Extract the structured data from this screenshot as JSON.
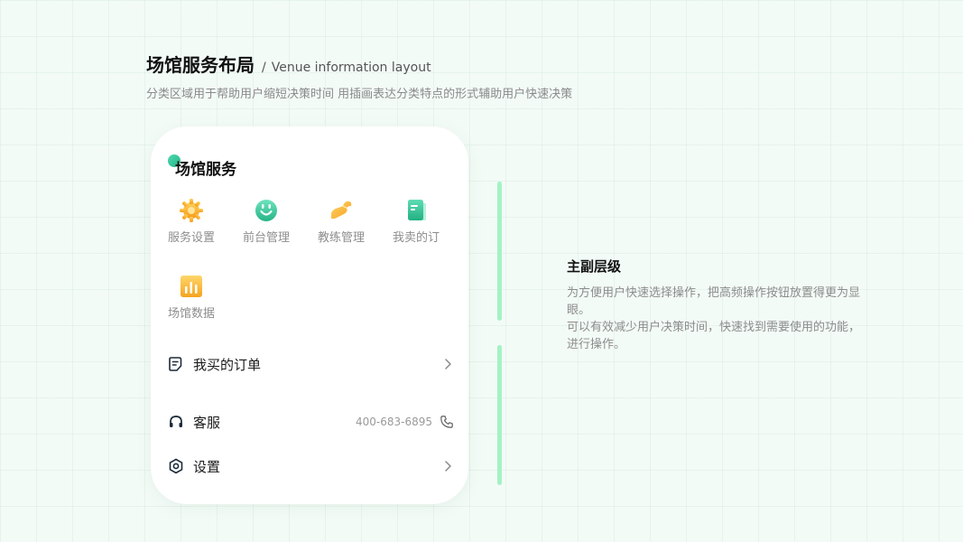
{
  "header": {
    "title": "场馆服务布局",
    "separator": "/",
    "subtitle_en": "Venue information layout",
    "description": "分类区域用于帮助用户缩短决策时间 用插画表达分类特点的形式辅助用户快速决策"
  },
  "card": {
    "title": "场馆服务",
    "grid": [
      {
        "label": "服务设置",
        "icon": "gear-icon"
      },
      {
        "label": "前台管理",
        "icon": "smiley-icon"
      },
      {
        "label": "教练管理",
        "icon": "arm-icon"
      },
      {
        "label": "我卖的订",
        "icon": "book-icon"
      },
      {
        "label": "场馆数据",
        "icon": "bar-chart-icon"
      }
    ],
    "list": [
      {
        "label": "我买的订单",
        "icon": "document-icon",
        "trailing": "chevron-right-icon"
      },
      {
        "label": "客服",
        "icon": "headset-icon",
        "value": "400-683-6895",
        "trailing": "phone-icon"
      },
      {
        "label": "设置",
        "icon": "hexagon-settings-icon",
        "trailing": "chevron-right-icon"
      }
    ]
  },
  "right": {
    "title": "主副层级",
    "desc_line1": "为方便用户快速选择操作，把高频操作按钮放置得更为显眼。",
    "desc_line2": "可以有效减少用户决策时间，快速找到需要使用的功能，进行操作。"
  },
  "colors": {
    "accent_green": "#2fc492",
    "bar_green": "#a4f2c5",
    "icon_orange": "#f7a823",
    "text_dark": "#1b2a3a"
  }
}
